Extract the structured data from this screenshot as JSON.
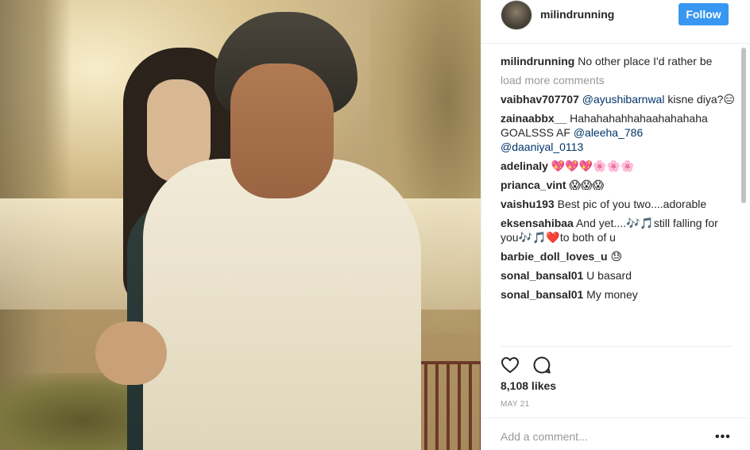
{
  "post": {
    "username": "milindrunning",
    "follow_label": "Follow",
    "caption": {
      "user": "milindrunning",
      "text": "No other place I'd rather be"
    },
    "load_more_label": "load more comments",
    "comments": [
      {
        "user": "vaibhav707707",
        "mention": "@ayushibarnwal",
        "text": " kisne diya?😑"
      },
      {
        "user": "zainaabbx__",
        "text": " Hahahahahhahaahahahaha GOALSSS AF ",
        "mention": "@aleeha_786",
        "mention2": "@daaniyal_0113"
      },
      {
        "user": "adelinaly",
        "text": " 💖💖💖🌸🌸🌸"
      },
      {
        "user": "prianca_vint",
        "text": " 😱😱😱"
      },
      {
        "user": "vaishu193",
        "text": " Best pic of you two....adorable"
      },
      {
        "user": "eksensahibaa",
        "text": " And yet....🎶🎵still falling for you🎶🎵❤️to both of u"
      },
      {
        "user": "barbie_doll_loves_u",
        "text": " 😓"
      },
      {
        "user": "sonal_bansal01",
        "text": " U basard"
      },
      {
        "user": "sonal_bansal01",
        "text": " My money"
      }
    ],
    "likes": "8,108 likes",
    "date": "MAY 21",
    "add_comment_placeholder": "Add a comment...",
    "more_label": "•••",
    "icons": {
      "like": "heart-icon",
      "comment": "comment-bubble-icon",
      "avatar": "profile-avatar"
    },
    "colors": {
      "follow_bg": "#3897f0",
      "mention": "#003569",
      "muted": "#999999"
    }
  }
}
